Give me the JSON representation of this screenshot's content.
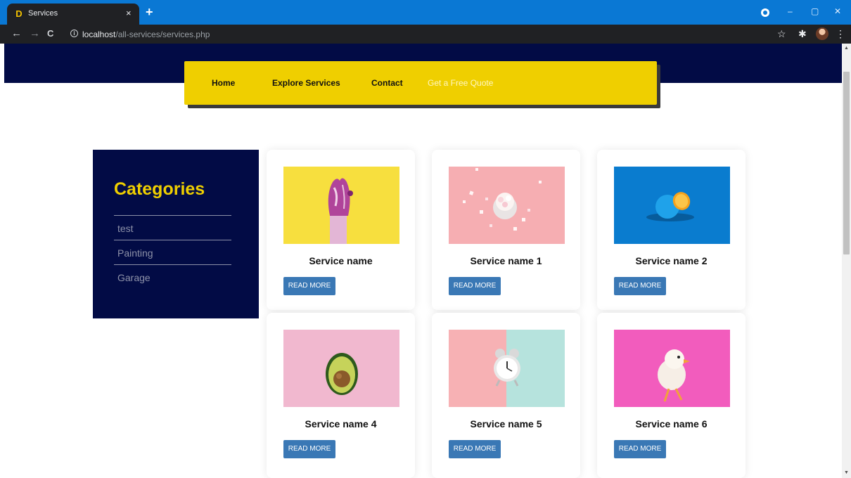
{
  "browser": {
    "tab_title": "Services",
    "tab_close": "×",
    "new_tab": "+",
    "url_host": "localhost",
    "url_path": "/all-services/services.php",
    "accent_color": "#0a78d4"
  },
  "icons": {
    "favicon": "D",
    "back": "←",
    "forward": "→",
    "reload": "C",
    "info": "i",
    "star": "☆",
    "extensions": "✱",
    "menu": "⋮",
    "minimize": "‒",
    "restore": "▢",
    "close": "✕",
    "scroll_up": "▲",
    "scroll_down": "▼"
  },
  "nav": {
    "home": "Home",
    "explore": "Explore Services",
    "contact": "Contact",
    "quote": "Get a Free Quote",
    "background_color": "#efcf00"
  },
  "categories": {
    "title": "Categories",
    "items": [
      "test",
      "Painting",
      "Garage"
    ]
  },
  "services": [
    {
      "name": "Service name",
      "button": "READ MORE",
      "image": "painted-hand-on-yellow"
    },
    {
      "name": "Service name 1",
      "button": "READ MORE",
      "image": "marshmallow-cup-on-pink"
    },
    {
      "name": "Service name 2",
      "button": "READ MORE",
      "image": "painted-orange-on-blue"
    },
    {
      "name": "Service name 4",
      "button": "READ MORE",
      "image": "avocado-on-pink"
    },
    {
      "name": "Service name 5",
      "button": "READ MORE",
      "image": "alarm-clock-on-pink-teal"
    },
    {
      "name": "Service name 6",
      "button": "READ MORE",
      "image": "chick-on-magenta"
    }
  ]
}
